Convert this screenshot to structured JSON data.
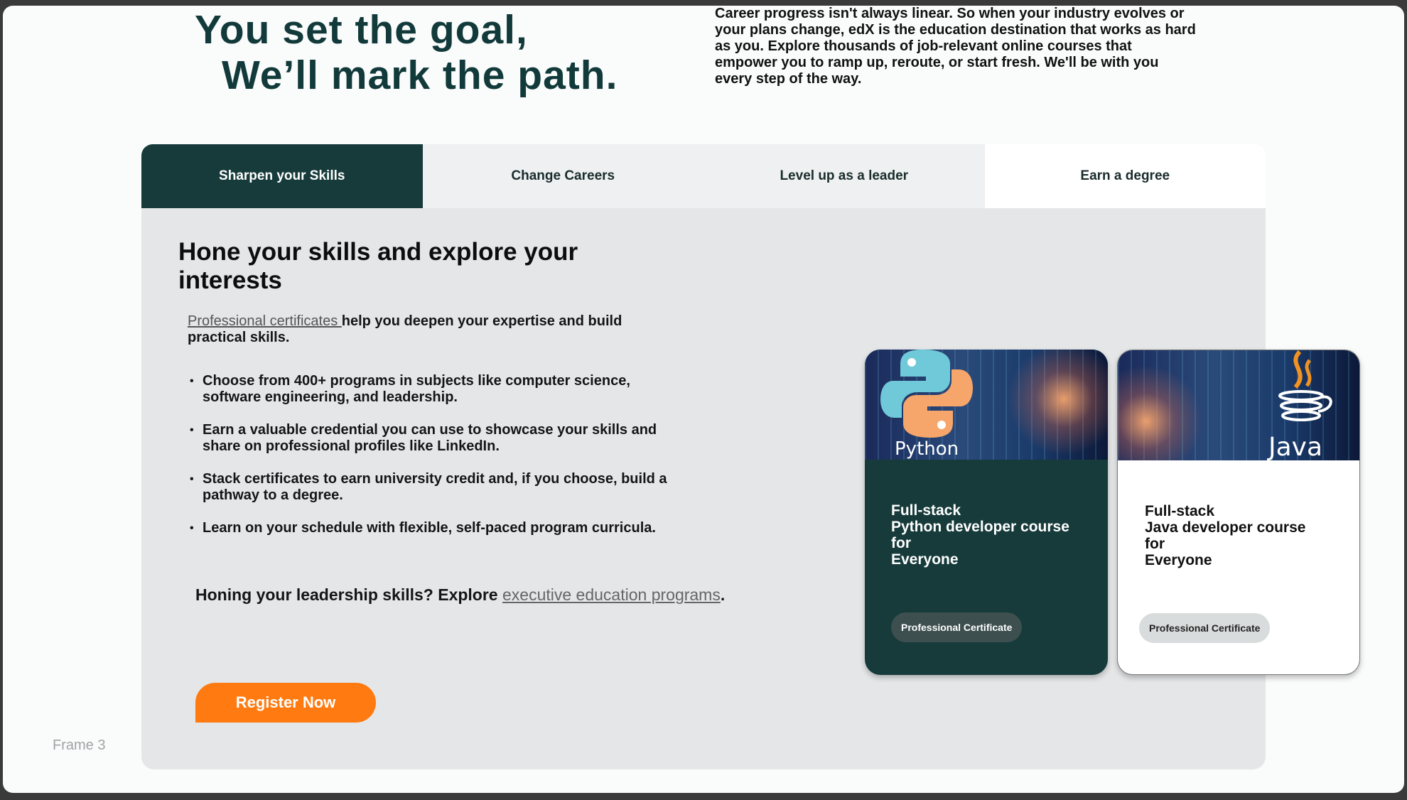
{
  "hero": {
    "title_line1": "You set the goal,",
    "title_line2": "We’ll mark the path.",
    "description": "Career progress isn't always linear. So when your industry evolves or your plans change, edX is the education destination that works as hard as you. Explore thousands of job-relevant online courses that empower you to ramp up, reroute, or start fresh. We'll be with you every step of the way."
  },
  "tabs": [
    {
      "label": "Sharpen your Skills",
      "active": true
    },
    {
      "label": "Change Careers",
      "active": false
    },
    {
      "label": "Level up as a leader",
      "active": false
    },
    {
      "label": "Earn a degree",
      "active": false
    }
  ],
  "content": {
    "heading": "Hone your skills and explore your interests",
    "intro_link": "Professional certificates ",
    "intro_text": "help you deepen your expertise and build practical skills.",
    "bullets": [
      "Choose from 400+ programs in subjects like computer science, software engineering, and leadership.",
      "Earn a valuable credential you can use to showcase your skills and share on professional profiles like LinkedIn.",
      "Stack certificates to earn university credit and, if you choose, build a pathway to a degree.",
      "Learn on your schedule with flexible, self-paced program curricula."
    ],
    "leader_text": "Honing your leadership skills? Explore ",
    "leader_link": "executive education programs",
    "leader_end": ".",
    "register_label": "Register Now"
  },
  "cards": [
    {
      "image_label": "Python",
      "title_lines": [
        "Full-stack",
        "Python developer course",
        "for",
        "Everyone"
      ],
      "badge": "Professional Certificate"
    },
    {
      "image_label": "Java",
      "title_lines": [
        "Full-stack",
        "Java developer course",
        "for",
        "Everyone"
      ],
      "badge": "Professional Certificate"
    }
  ],
  "frame_label": "Frame 3",
  "colors": {
    "brand_dark": "#173b3b",
    "accent_orange": "#ff7a10"
  }
}
